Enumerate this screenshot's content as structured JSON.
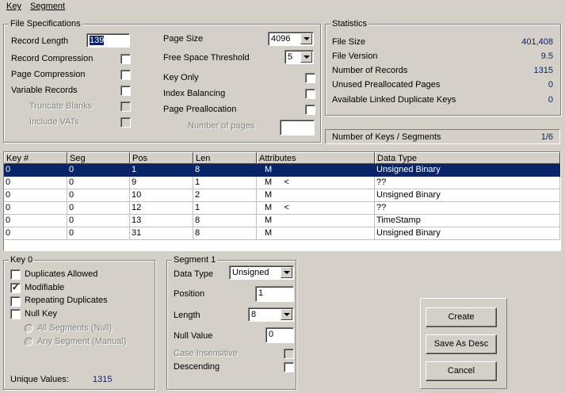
{
  "menu": {
    "key": "Key",
    "segment": "Segment"
  },
  "file_spec": {
    "title": "File Specifications",
    "record_length_label": "Record Length",
    "record_length_value": "139",
    "record_compression": "Record Compression",
    "page_compression": "Page Compression",
    "variable_records": "Variable Records",
    "truncate_blanks": "Truncate Blanks",
    "include_vats": "Include VATs",
    "page_size_label": "Page Size",
    "page_size_value": "4096",
    "free_space_label": "Free Space Threshold",
    "free_space_value": "5",
    "key_only": "Key Only",
    "index_balancing": "Index Balancing",
    "page_preallocation": "Page Preallocation",
    "number_of_pages": "Number of pages",
    "number_of_pages_value": ""
  },
  "statistics": {
    "title": "Statistics",
    "items": [
      {
        "label": "File Size",
        "value": "401,408"
      },
      {
        "label": "File Version",
        "value": "9.5"
      },
      {
        "label": "Number of Records",
        "value": "1315"
      },
      {
        "label": "Unused Preallocated Pages",
        "value": "0"
      },
      {
        "label": "Available Linked Duplicate Keys",
        "value": "0"
      }
    ],
    "keys_segments_label": "Number of Keys / Segments",
    "keys_segments_value": "1/6"
  },
  "table": {
    "columns": [
      "Key #",
      "Seg",
      "Pos",
      "Len",
      "Attributes",
      "Data Type"
    ],
    "rows": [
      [
        "0",
        "0",
        "1",
        "8",
        "M",
        "Unsigned Binary"
      ],
      [
        "0",
        "0",
        "9",
        "1",
        "M     <",
        "??"
      ],
      [
        "0",
        "0",
        "10",
        "2",
        "M",
        "Unsigned Binary"
      ],
      [
        "0",
        "0",
        "12",
        "1",
        "M     <",
        "??"
      ],
      [
        "0",
        "0",
        "13",
        "8",
        "M",
        "TimeStamp"
      ],
      [
        "0",
        "0",
        "31",
        "8",
        "M",
        "Unsigned Binary"
      ]
    ]
  },
  "key_panel": {
    "title": "Key 0",
    "duplicates_allowed": "Duplicates Allowed",
    "modifiable": "Modifiable",
    "repeating_duplicates": "Repeating Duplicates",
    "null_key": "Null Key",
    "all_segments": "All Segments (Null)",
    "any_segment": "Any Segment (Manual)",
    "unique_values_label": "Unique Values:",
    "unique_values_value": "1315"
  },
  "segment_panel": {
    "title": "Segment 1",
    "data_type_label": "Data Type",
    "data_type_value": "Unsigned",
    "position_label": "Position",
    "position_value": "1",
    "length_label": "Length",
    "length_value": "8",
    "null_value_label": "Null Value",
    "null_value_value": "0",
    "case_insensitive": "Case Insensitive",
    "descending": "Descending"
  },
  "buttons": {
    "create": "Create",
    "save_as_desc": "Save As Desc",
    "cancel": "Cancel"
  }
}
